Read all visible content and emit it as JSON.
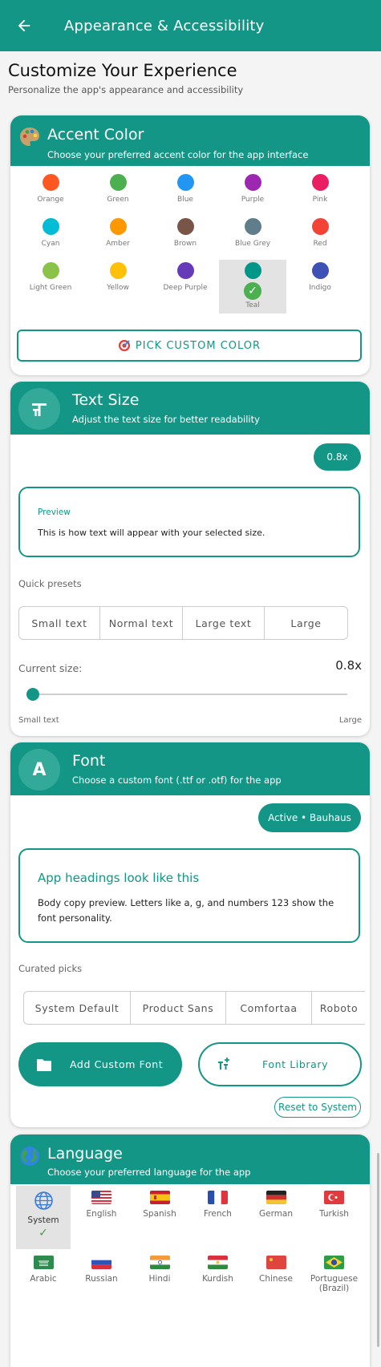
{
  "appbar": {
    "title": "Appearance & Accessibility"
  },
  "page": {
    "heading": "Customize Your Experience",
    "subheading": "Personalize the app's appearance and accessibility"
  },
  "accent": {
    "title": "Accent Color",
    "subtitle": "Choose your preferred accent color for the app interface",
    "colors": [
      {
        "name": "Orange",
        "hex": "#ff5722"
      },
      {
        "name": "Green",
        "hex": "#4caf50"
      },
      {
        "name": "Blue",
        "hex": "#2196f3"
      },
      {
        "name": "Purple",
        "hex": "#9c27b0"
      },
      {
        "name": "Pink",
        "hex": "#e91e63"
      },
      {
        "name": "Cyan",
        "hex": "#00bcd4"
      },
      {
        "name": "Amber",
        "hex": "#ff9800"
      },
      {
        "name": "Brown",
        "hex": "#795548"
      },
      {
        "name": "Blue Grey",
        "hex": "#607d8b"
      },
      {
        "name": "Red",
        "hex": "#f44336"
      },
      {
        "name": "Light Green",
        "hex": "#8bc34a"
      },
      {
        "name": "Yellow",
        "hex": "#ffc107"
      },
      {
        "name": "Deep Purple",
        "hex": "#673ab7"
      },
      {
        "name": "Teal",
        "hex": "#009688"
      },
      {
        "name": "Indigo",
        "hex": "#3f51b5"
      }
    ],
    "selected": "Teal",
    "pick_label": "PICK CUSTOM COLOR"
  },
  "text_size": {
    "title": "Text Size",
    "subtitle": "Adjust the text size for better readability",
    "badge": "0.8x",
    "preview_label": "Preview",
    "preview_text": "This is how text will appear with your selected size.",
    "presets_label": "Quick presets",
    "presets": [
      "Small text",
      "Normal text",
      "Large text",
      "Large"
    ],
    "current_label": "Current size:",
    "current_value": "0.8x",
    "slider_fraction": 0.0,
    "min_label": "Small text",
    "max_label": "Large"
  },
  "font": {
    "title": "Font",
    "subtitle": "Choose a custom font (.ttf or .otf) for the app",
    "icon_letter": "A",
    "active_badge": "Active • Bauhaus",
    "preview_heading": "App headings look like this",
    "preview_body": "Body copy preview. Letters like a, g, and numbers 123 show the font personality.",
    "curated_label": "Curated picks",
    "curated": [
      "System Default",
      "Product Sans",
      "Comfortaa",
      "Roboto"
    ],
    "add_label": "Add Custom Font",
    "library_label": "Font Library",
    "reset_label": "Reset to System"
  },
  "language": {
    "title": "Language",
    "subtitle": "Choose your preferred language for the app",
    "items": [
      {
        "label": "System",
        "flag": "globe-icon"
      },
      {
        "label": "English",
        "flag": "us-flag"
      },
      {
        "label": "Spanish",
        "flag": "spain-flag"
      },
      {
        "label": "French",
        "flag": "france-flag"
      },
      {
        "label": "German",
        "flag": "germany-flag"
      },
      {
        "label": "Turkish",
        "flag": "turkey-flag"
      },
      {
        "label": "Arabic",
        "flag": "saudi-flag"
      },
      {
        "label": "Russian",
        "flag": "russia-flag"
      },
      {
        "label": "Hindi",
        "flag": "india-flag"
      },
      {
        "label": "Kurdish",
        "flag": "kurdistan-flag"
      },
      {
        "label": "Chinese",
        "flag": "china-flag"
      },
      {
        "label": "Portuguese (Brazil)",
        "flag": "brazil-flag"
      }
    ],
    "selected": "System"
  },
  "colors": {
    "primary": "#139686"
  }
}
